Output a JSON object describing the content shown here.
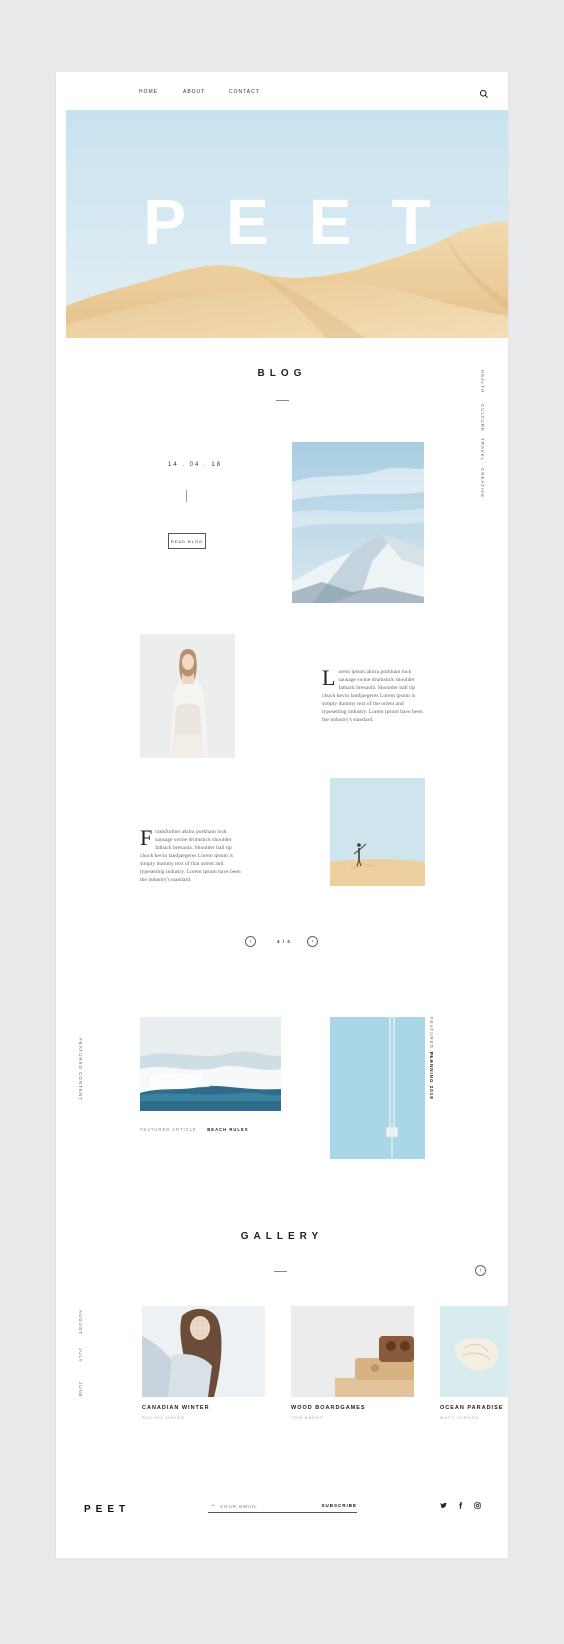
{
  "nav": {
    "links": [
      "HOME",
      "ABOUT",
      "CONTACT"
    ]
  },
  "hero": {
    "title": "PEET"
  },
  "blog": {
    "title": "BLOG",
    "categories": [
      "HEALTH",
      "CULTURE",
      "TRAVEL",
      "CREATIVE"
    ],
    "post_date": "14 . 04 . 18",
    "read_button": "READ BLOG",
    "paragraph1": {
      "dropcap": "L",
      "text": "orem ipsum akitra porkham luck sausage swine drumstick shoulder fatback bresaola. Shoulder ball tip chuck kevin landjaegeres Lorem ipsum is simply dummy text of the orient and typesetting industry. Lorem ipsum have been the industry's standard."
    },
    "paragraph2": {
      "dropcap": "F",
      "text": "rankfurther akitra porkham luck sausage swine drumstick shoulder fatback bresaola. Shoulder ball tip chuck kevin landjaegeres Lorem ipsum is simply dummy text of that orient and typesetting industry. Lorem ipsum have been the industry's standard."
    },
    "pager": "4 / 4"
  },
  "featured": {
    "side_label": "FEATURED CONTENT",
    "article_label": "FEATURED ARTICLE",
    "article_title": "BEACH RULES",
    "side_label_right": "FEATURED SHE",
    "side_title_right": "PLANNING 2018"
  },
  "gallery": {
    "title": "GALLERY",
    "months": [
      "AUGUST",
      "JULY",
      "JUNE"
    ],
    "items": [
      {
        "title": "CANADIAN WINTER",
        "author": "RACHEL DAKER"
      },
      {
        "title": "WOOD BOARDGAMES",
        "author": "TOM BARRY"
      },
      {
        "title": "OCEAN PARADISE",
        "author": "MATT JORDEN"
      }
    ]
  },
  "footer": {
    "logo": "PEET",
    "email_placeholder": "YOUR EMAIL",
    "subscribe": "SUBSCRIBE",
    "social": [
      "twitter-icon",
      "facebook-icon",
      "instagram-icon"
    ]
  }
}
